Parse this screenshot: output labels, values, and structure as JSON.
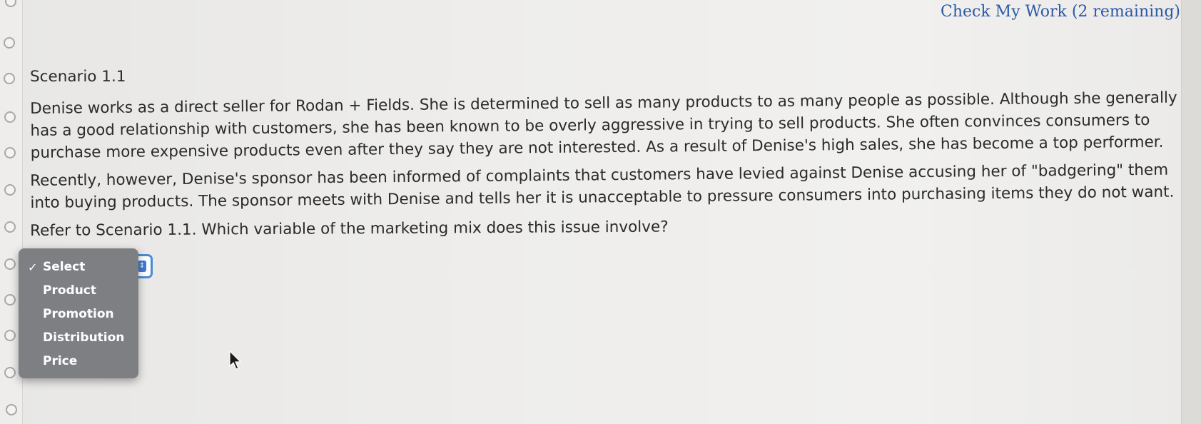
{
  "header": {
    "check_my_work": "Check My Work (2 remaining)"
  },
  "scenario": {
    "title": "Scenario 1.1",
    "paragraph_1": "Denise works as a direct seller for Rodan + Fields. She is determined to sell as many products to as many people as possible. Although she generally has a good relationship with customers, she has been known to be overly aggressive in trying to sell products. She often convinces consumers to purchase more expensive products even after they say they are not interested. As a result of Denise's high sales, she has become a top performer.",
    "paragraph_2": "Recently, however, Denise's sponsor has been informed of complaints that customers have levied against Denise accusing her of \"badgering\" them into buying products. The sponsor meets with Denise and tells her it is unacceptable to pressure consumers into purchasing items they do not want.",
    "question": "Refer to Scenario 1.1. Which variable of the marketing mix does this issue involve?"
  },
  "dropdown": {
    "selected": "Select",
    "check_glyph": "✓",
    "options": [
      "Select",
      "Product",
      "Promotion",
      "Distribution",
      "Price"
    ]
  },
  "colors": {
    "link": "#2a5aa6",
    "dropdown_bg": "#7e7f83",
    "select_border": "#4a8ad8",
    "text": "#2b2b2b"
  },
  "icons": {
    "cursor": "mouse-pointer-icon",
    "rail": "radio-circle-icon"
  }
}
